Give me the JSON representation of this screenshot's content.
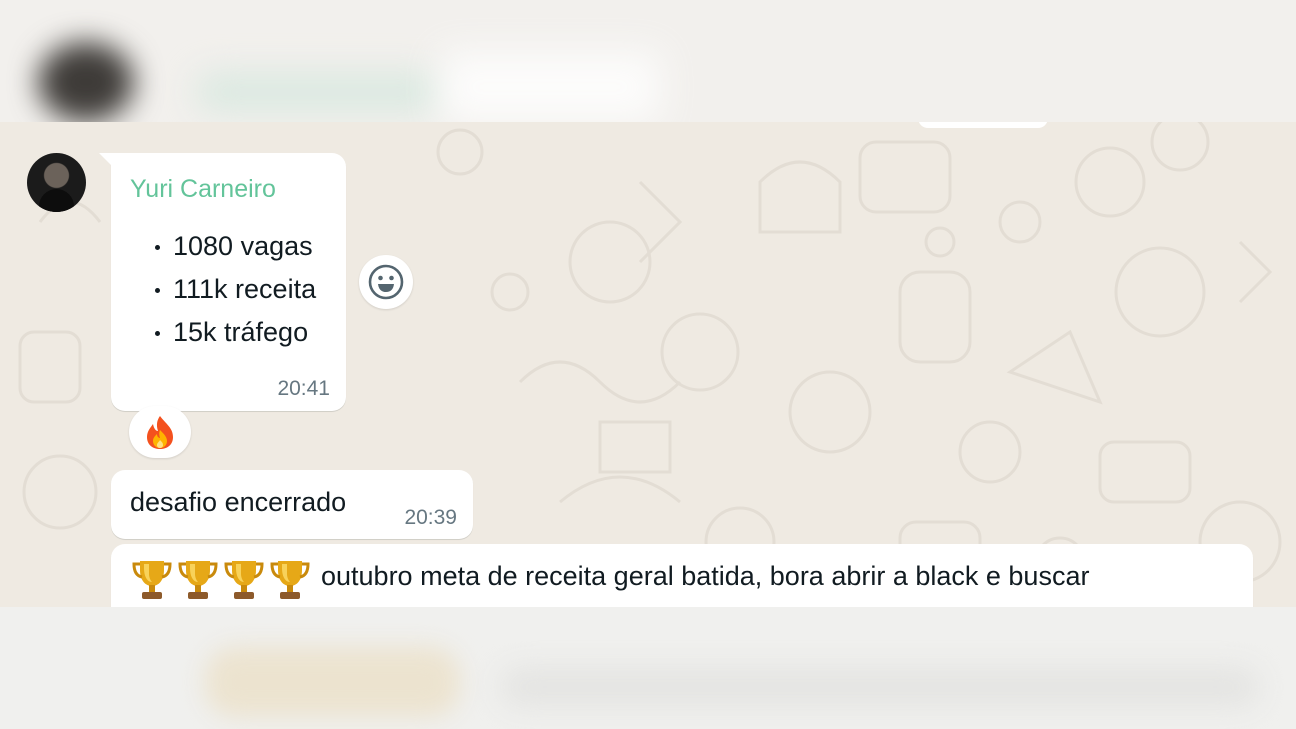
{
  "chat": {
    "messages": [
      {
        "sender": "Yuri Carneiro",
        "bullets": [
          "1080 vagas",
          "111k receita",
          "15k tráfego"
        ],
        "time": "20:41",
        "reaction": "🔥"
      },
      {
        "text": "desafio encerrado",
        "time": "20:39"
      },
      {
        "prefix_icons": [
          "trophy-icon",
          "trophy-icon",
          "trophy-icon",
          "trophy-icon"
        ],
        "text": "outubro meta de receita geral batida, bora abrir a black e buscar"
      }
    ],
    "colors": {
      "wallpaper": "#efeae2",
      "bubble": "#ffffff",
      "sender_name": "#63c49a",
      "timestamp": "#667781"
    }
  }
}
